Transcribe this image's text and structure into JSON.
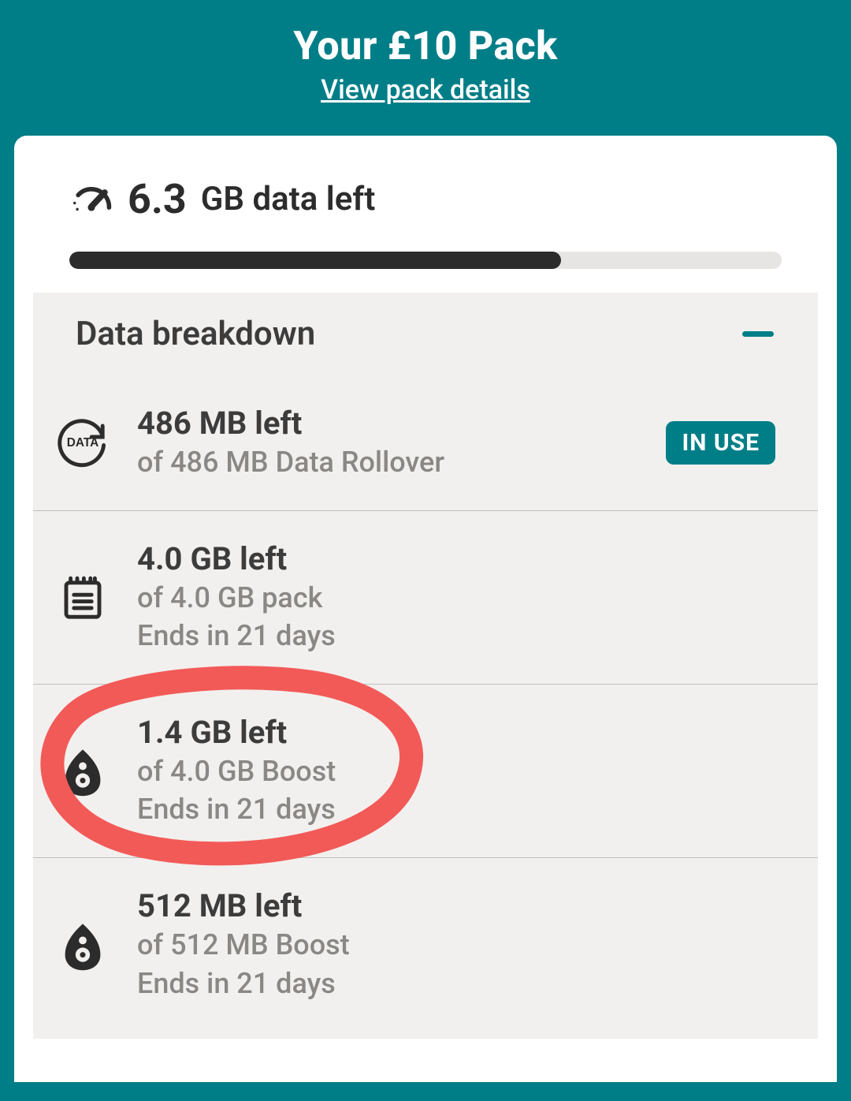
{
  "header": {
    "title": "Your £10 Pack",
    "link": "View pack details"
  },
  "summary": {
    "value": "6.3",
    "unit": "GB data left",
    "progress_pct": 69
  },
  "breakdown": {
    "title": "Data breakdown",
    "items": [
      {
        "icon": "data-rollover-icon",
        "line1": "486 MB left",
        "line2": "of 486 MB Data Rollover",
        "line3": "",
        "badge": "IN USE"
      },
      {
        "icon": "pack-icon",
        "line1": "4.0 GB left",
        "line2": "of 4.0 GB pack",
        "line3": "Ends in 21 days",
        "badge": ""
      },
      {
        "icon": "boost-icon",
        "line1": "1.4 GB left",
        "line2": "of 4.0 GB Boost",
        "line3": "Ends in 21 days",
        "badge": "",
        "annotated": true
      },
      {
        "icon": "boost-icon",
        "line1": "512 MB left",
        "line2": "of 512 MB Boost",
        "line3": "Ends in 21 days",
        "badge": ""
      }
    ]
  }
}
